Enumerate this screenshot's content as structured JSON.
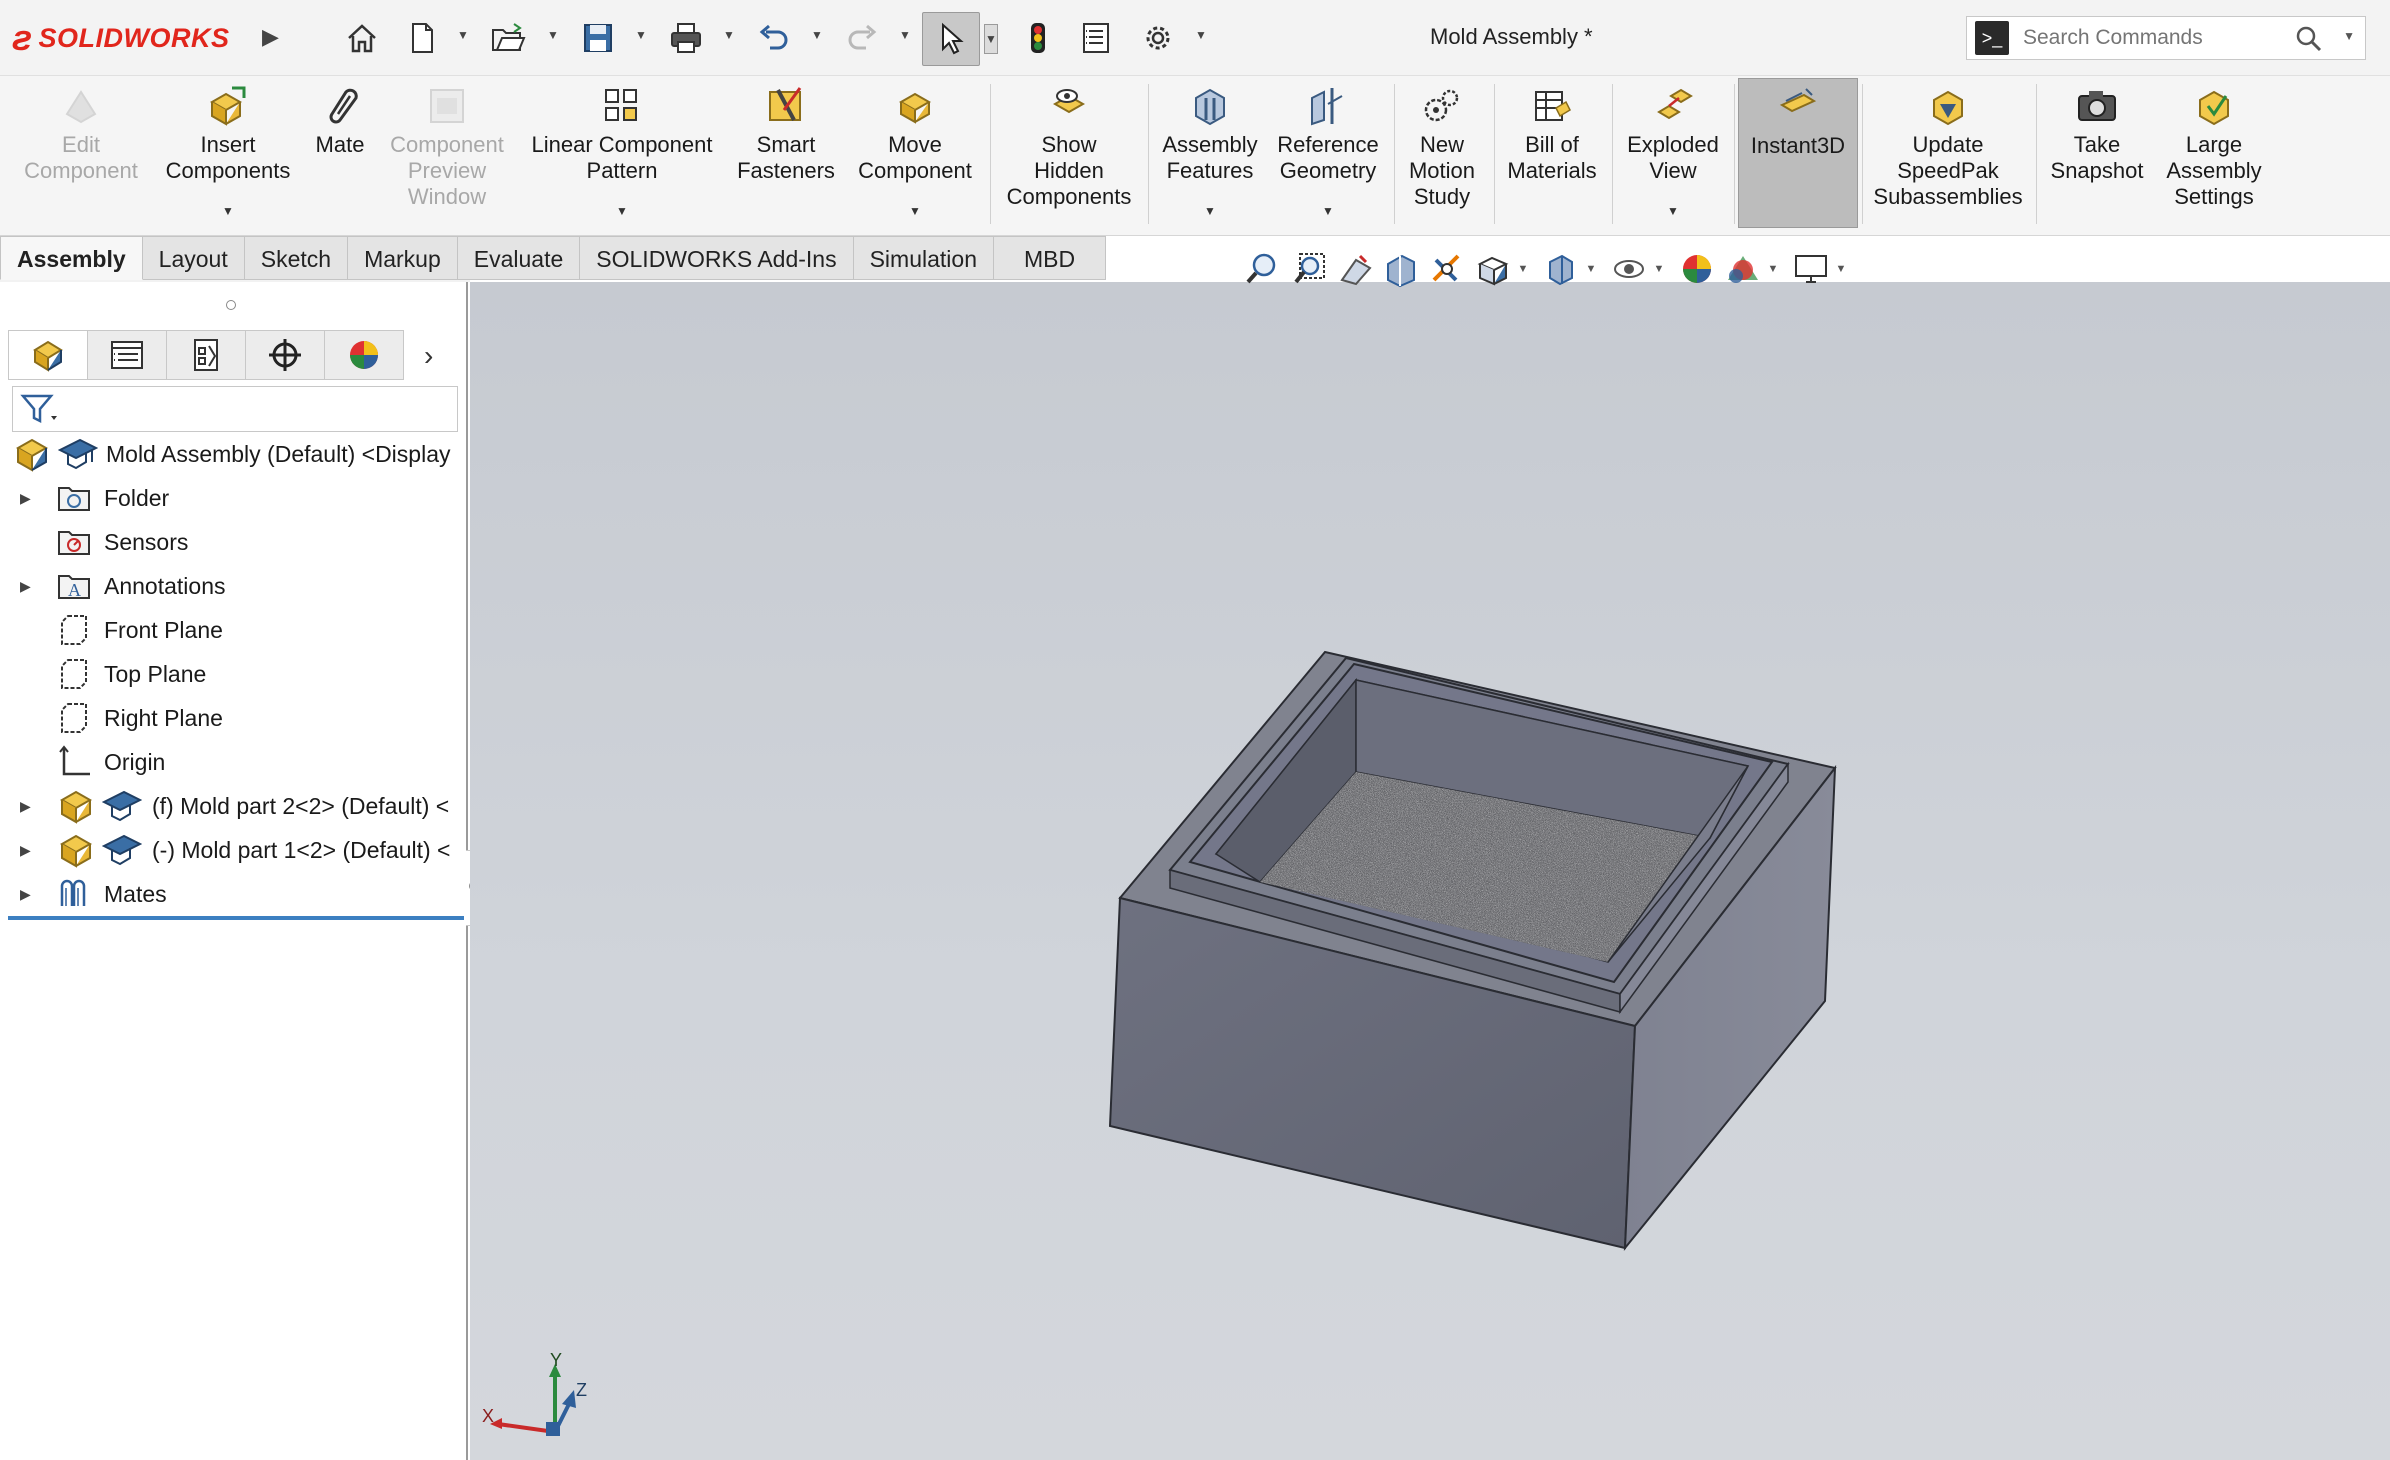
{
  "app": {
    "brand_prefix": "SOLID",
    "brand_suffix": "WORKS",
    "document_title": "Mold Assembly *"
  },
  "quick_access": {
    "icons": [
      "home-icon",
      "new-document-icon",
      "open-icon",
      "save-icon",
      "print-icon",
      "undo-icon",
      "redo-icon",
      "select-icon",
      "rebuild-icon",
      "file-properties-icon",
      "options-icon"
    ]
  },
  "search": {
    "placeholder": "Search Commands"
  },
  "ribbon": {
    "buttons": [
      {
        "label": "Edit\nComponent",
        "enabled": false,
        "icon": "edit-component-icon"
      },
      {
        "label": "Insert\nComponents",
        "enabled": true,
        "icon": "insert-components-icon"
      },
      {
        "label": "Mate",
        "enabled": true,
        "icon": "mate-icon"
      },
      {
        "label": "Component\nPreview\nWindow",
        "enabled": false,
        "icon": "component-preview-icon"
      },
      {
        "label": "Linear Component\nPattern",
        "enabled": true,
        "icon": "linear-pattern-icon"
      },
      {
        "label": "Smart\nFasteners",
        "enabled": true,
        "icon": "smart-fasteners-icon"
      },
      {
        "label": "Move\nComponent",
        "enabled": true,
        "icon": "move-component-icon"
      },
      {
        "label": "Show\nHidden\nComponents",
        "enabled": true,
        "icon": "show-hidden-icon"
      },
      {
        "label": "Assembly\nFeatures",
        "enabled": true,
        "icon": "assembly-features-icon"
      },
      {
        "label": "Reference\nGeometry",
        "enabled": true,
        "icon": "reference-geometry-icon"
      },
      {
        "label": "New\nMotion\nStudy",
        "enabled": true,
        "icon": "motion-study-icon"
      },
      {
        "label": "Bill of\nMaterials",
        "enabled": true,
        "icon": "bom-icon"
      },
      {
        "label": "Exploded\nView",
        "enabled": true,
        "icon": "exploded-view-icon"
      },
      {
        "label": "Instant3D",
        "enabled": true,
        "icon": "instant3d-icon",
        "active": true
      },
      {
        "label": "Update\nSpeedPak\nSubassemblies",
        "enabled": true,
        "icon": "speedpak-icon"
      },
      {
        "label": "Take\nSnapshot",
        "enabled": true,
        "icon": "snapshot-icon"
      },
      {
        "label": "Large\nAssembly\nSettings",
        "enabled": true,
        "icon": "large-assembly-icon"
      }
    ]
  },
  "tabs": [
    "Assembly",
    "Layout",
    "Sketch",
    "Markup",
    "Evaluate",
    "SOLIDWORKS Add-Ins",
    "Simulation",
    "MBD"
  ],
  "active_tab": "Assembly",
  "feature_tree": {
    "root": "Mold Assembly (Default) <Display",
    "items": [
      {
        "label": "Folder",
        "icon": "folder-icon",
        "expandable": true
      },
      {
        "label": "Sensors",
        "icon": "sensor-icon",
        "expandable": false
      },
      {
        "label": "Annotations",
        "icon": "annotations-icon",
        "expandable": true
      },
      {
        "label": "Front Plane",
        "icon": "plane-icon",
        "expandable": false
      },
      {
        "label": "Top Plane",
        "icon": "plane-icon",
        "expandable": false
      },
      {
        "label": "Right Plane",
        "icon": "plane-icon",
        "expandable": false
      },
      {
        "label": "Origin",
        "icon": "origin-icon",
        "expandable": false
      },
      {
        "label": "(f) Mold part 2<2> (Default) <",
        "icon": "part-icon",
        "expandable": true
      },
      {
        "label": "(-) Mold part 1<2> (Default) <",
        "icon": "part-icon",
        "expandable": true
      },
      {
        "label": "Mates",
        "icon": "mates-icon",
        "expandable": true
      }
    ]
  },
  "triad": {
    "x": "X",
    "y": "Y",
    "z": "Z"
  },
  "colors": {
    "accent": "#e1261c",
    "model_top": "#7b7f8d",
    "model_front": "#6b6e7b",
    "model_side": "#828594",
    "viewport_bg": "#c9cdd3",
    "selection_line": "#3c7fc1"
  }
}
